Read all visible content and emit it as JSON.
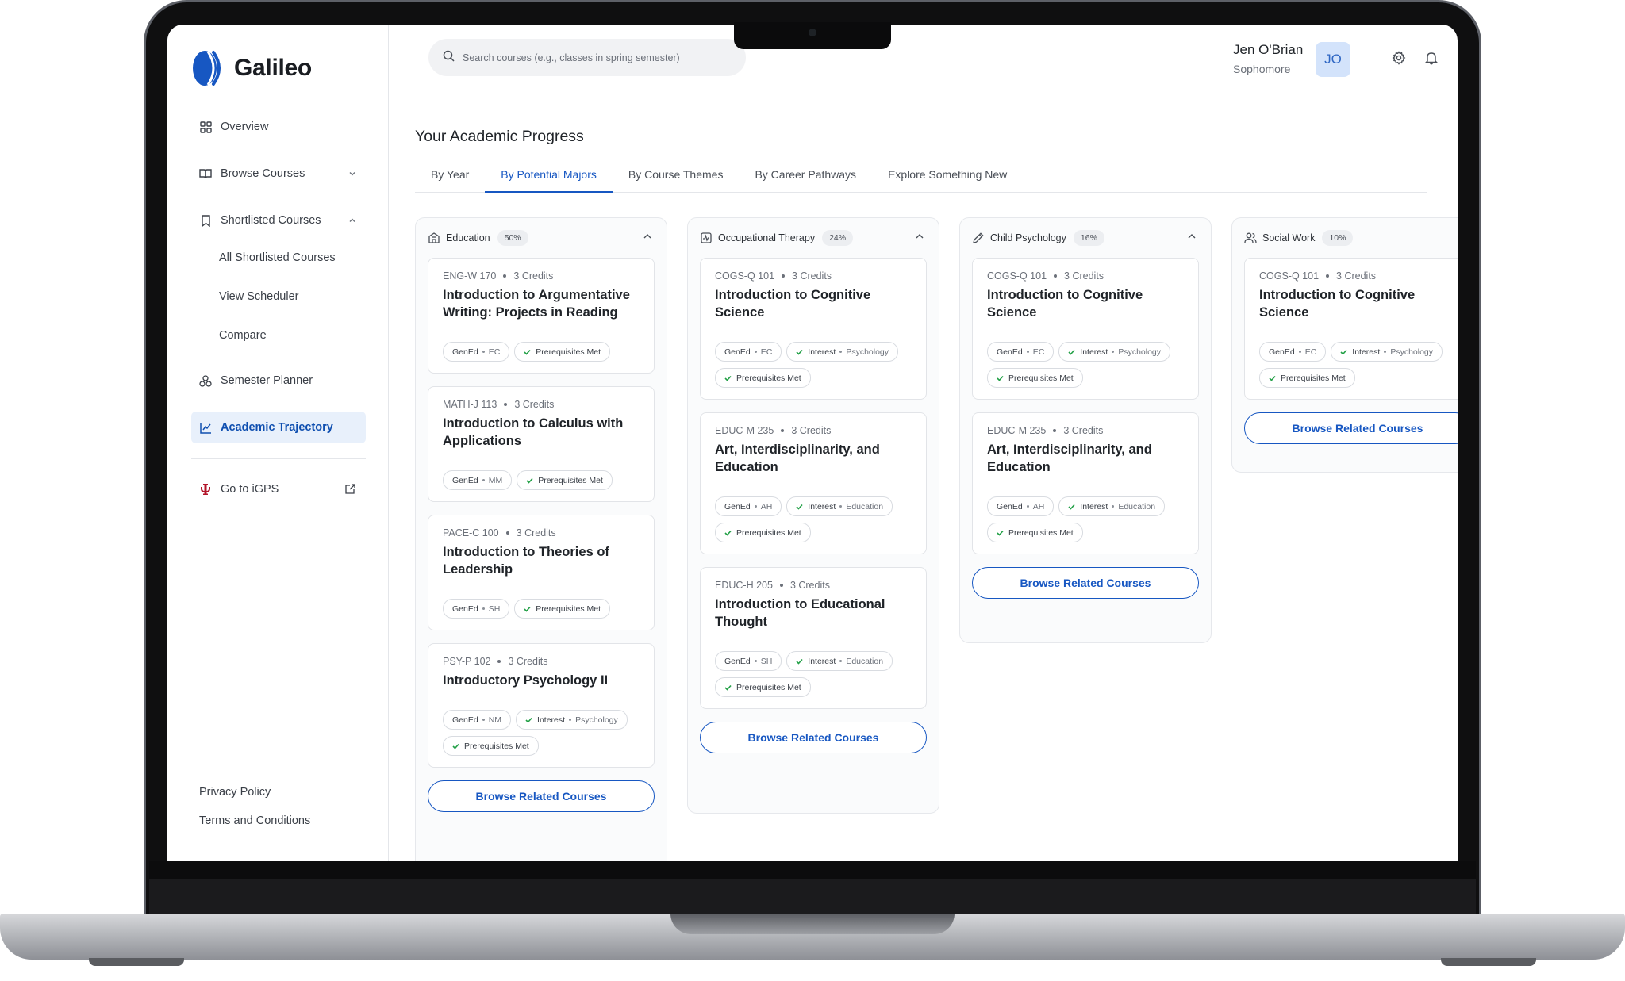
{
  "app": {
    "name": "Galileo",
    "brand_color": "#1757c2"
  },
  "sidebar": {
    "items": [
      {
        "label": "Overview",
        "icon": "grid-icon"
      },
      {
        "label": "Browse Courses",
        "icon": "book-icon"
      },
      {
        "label": "Shortlisted Courses",
        "icon": "bookmark-icon"
      },
      {
        "label": "Semester Planner",
        "icon": "planner-icon"
      },
      {
        "label": "Academic Trajectory",
        "icon": "chart-line-icon",
        "active": true
      },
      {
        "label": "Go to iGPS",
        "icon": "iu-logo-icon"
      }
    ],
    "sub_items": [
      "All Shortlisted Courses",
      "View Scheduler",
      "Compare"
    ],
    "footer": {
      "privacy": "Privacy Policy",
      "terms": "Terms and Conditions"
    }
  },
  "header": {
    "search_placeholder": "Search courses (e.g., classes in spring semester)",
    "user_name": "Jen O'Brian",
    "user_role": "Sophomore",
    "avatar_initials": "JO"
  },
  "main": {
    "title": "Your Academic Progress",
    "tabs": [
      "By Year",
      "By Potential Majors",
      "By Course Themes",
      "By Career Pathways",
      "Explore Something New"
    ],
    "active_tab": "By Potential Majors",
    "browse_label": "Browse Related Courses",
    "columns": [
      {
        "name": "Education",
        "percent": "50%",
        "icon": "school-icon",
        "courses": [
          {
            "code": "ENG-W 170",
            "credits": "3 Credits",
            "title": "Introduction to Argumentative Writing: Projects in Reading a...",
            "gened": "GenEd",
            "gened_code": "EC",
            "prereq": "Prerequisites Met"
          },
          {
            "code": "MATH-J 113",
            "credits": "3 Credits",
            "title": "Introduction to Calculus with Applications",
            "gened": "GenEd",
            "gened_code": "MM",
            "prereq": "Prerequisites Met"
          },
          {
            "code": "PACE-C 100",
            "credits": "3 Credits",
            "title": "Introduction to Theories of Leadership",
            "gened": "GenEd",
            "gened_code": "SH",
            "prereq": "Prerequisites Met"
          },
          {
            "code": "PSY-P 102",
            "credits": "3 Credits",
            "title": "Introductory Psychology II",
            "gened": "GenEd",
            "gened_code": "NM",
            "interest": "Interest",
            "interest_area": "Psychology",
            "prereq": "Prerequisites Met"
          }
        ]
      },
      {
        "name": "Occupational Therapy",
        "percent": "24%",
        "icon": "therapy-icon",
        "courses": [
          {
            "code": "COGS-Q 101",
            "credits": "3 Credits",
            "title": "Introduction to Cognitive Science",
            "gened": "GenEd",
            "gened_code": "EC",
            "interest": "Interest",
            "interest_area": "Psychology",
            "prereq": "Prerequisites Met"
          },
          {
            "code": "EDUC-M 235",
            "credits": "3 Credits",
            "title": "Art, Interdisciplinarity, and Education",
            "gened": "GenEd",
            "gened_code": "AH",
            "interest": "Interest",
            "interest_area": "Education",
            "prereq": "Prerequisites Met"
          },
          {
            "code": "EDUC-H 205",
            "credits": "3 Credits",
            "title": "Introduction to Educational Thought",
            "gened": "GenEd",
            "gened_code": "SH",
            "interest": "Interest",
            "interest_area": "Education",
            "prereq": "Prerequisites Met"
          }
        ]
      },
      {
        "name": "Child Psychology",
        "percent": "16%",
        "icon": "pencil-icon",
        "courses": [
          {
            "code": "COGS-Q 101",
            "credits": "3 Credits",
            "title": "Introduction to Cognitive Science",
            "gened": "GenEd",
            "gened_code": "EC",
            "interest": "Interest",
            "interest_area": "Psychology",
            "prereq": "Prerequisites Met"
          },
          {
            "code": "EDUC-M 235",
            "credits": "3 Credits",
            "title": "Art, Interdisciplinarity, and Education",
            "gened": "GenEd",
            "gened_code": "AH",
            "interest": "Interest",
            "interest_area": "Education",
            "prereq": "Prerequisites Met"
          }
        ]
      },
      {
        "name": "Social Work",
        "percent": "10%",
        "icon": "people-icon",
        "courses": [
          {
            "code": "COGS-Q 101",
            "credits": "3 Credits",
            "title": "Introduction to Cognitive Science",
            "gened": "GenEd",
            "gened_code": "EC",
            "interest": "Interest",
            "interest_area": "Psychology",
            "prereq": "Prerequisites Met"
          }
        ]
      }
    ]
  }
}
